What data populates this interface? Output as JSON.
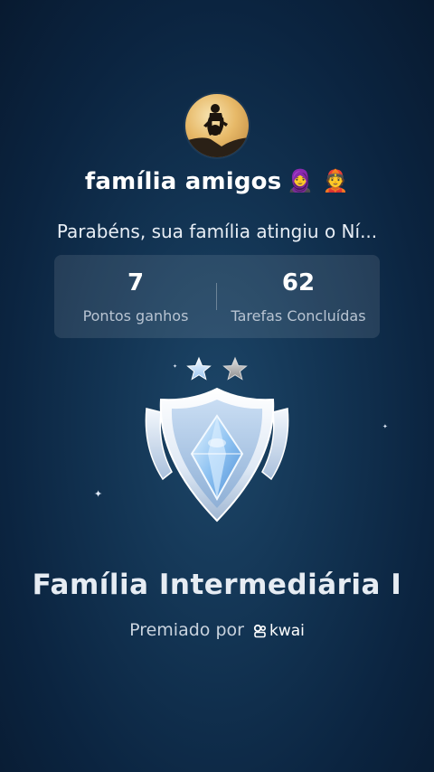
{
  "profile": {
    "family_name": "família amigos",
    "emojis": "🧕 👲",
    "avatar_icon": "parent-lifting-child-silhouette"
  },
  "message": "Parabéns, sua família atingiu o Ní...",
  "stats": {
    "points": {
      "value": "7",
      "label": "Pontos ganhos"
    },
    "tasks": {
      "value": "62",
      "label": "Tarefas Concluídas"
    }
  },
  "rating": {
    "total_stars": 2,
    "filled_stars": 1,
    "colors": {
      "filled": "#cfe4ff",
      "empty": "#b9b9b9"
    }
  },
  "badge": {
    "icon": "diamond-shield-badge-icon",
    "colors": {
      "shield": "#eef4fb",
      "crystal": "#7fb6ee",
      "shadow": "#6c8aae"
    }
  },
  "level": {
    "title": "Família Intermediária I"
  },
  "awarded": {
    "prefix": "Premiado por",
    "brand": "kwai",
    "brand_icon": "kwai-logo-icon"
  },
  "theme": {
    "background_dark": "#081a30",
    "background_light": "#1d4668",
    "card_bg": "rgba(255,255,255,0.10)"
  }
}
